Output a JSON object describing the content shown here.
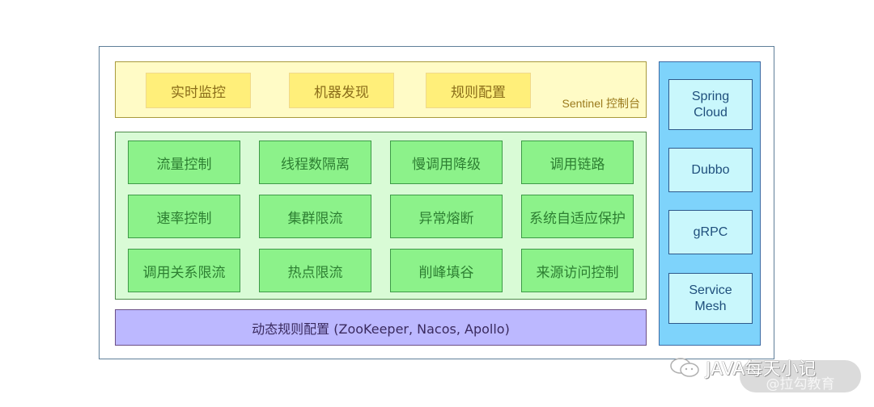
{
  "console": {
    "label": "Sentinel 控制台",
    "items": [
      "实时监控",
      "机器发现",
      "规则配置"
    ]
  },
  "features": {
    "rows": [
      [
        "流量控制",
        "线程数隔离",
        "慢调用降级",
        "调用链路"
      ],
      [
        "速率控制",
        "集群限流",
        "异常熔断",
        "系统自适应保护"
      ],
      [
        "调用关系限流",
        "热点限流",
        "削峰填谷",
        "来源访问控制"
      ]
    ]
  },
  "dynamic_rules": {
    "label": "动态规则配置 (ZooKeeper, Nacos, Apollo)"
  },
  "adapters": {
    "items": [
      "Spring\nCloud",
      "Dubbo",
      "gRPC",
      "Service\nMesh"
    ]
  },
  "watermark": {
    "text": "JAVA每天小记",
    "sub": "@拉勾教育",
    "icon": "wechat-icon"
  },
  "colors": {
    "console_bg": "#fffbc6",
    "console_item_bg": "#ffef7a",
    "feature_bg": "#d9fbd6",
    "feature_item_bg": "#8cf28a",
    "dynamic_bg": "#bcb8ff",
    "adapter_bg": "#7ed3fb",
    "adapter_item_bg": "#c9f7fc"
  }
}
